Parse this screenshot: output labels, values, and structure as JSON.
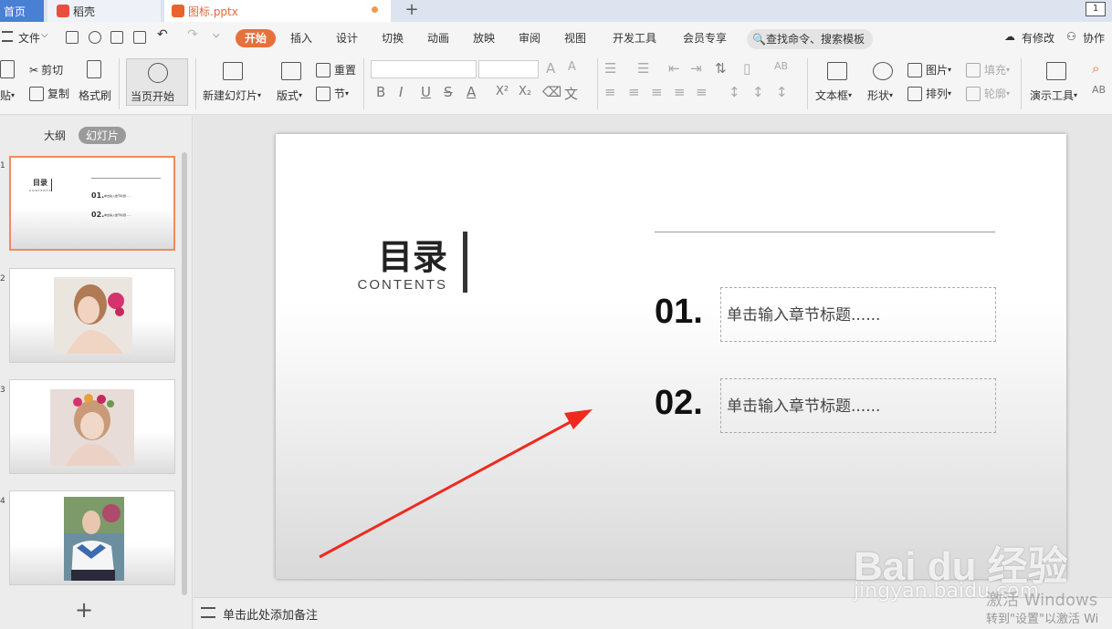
{
  "tabs": {
    "home": "首页",
    "docer": "稻壳",
    "file": "图标.pptx",
    "new_tab": "+",
    "window_badge": "1"
  },
  "menu": {
    "file": "文件",
    "items": [
      "开始",
      "插入",
      "设计",
      "切换",
      "动画",
      "放映",
      "审阅",
      "视图",
      "开发工具",
      "会员专享"
    ],
    "search_placeholder": "查找命令、搜索模板",
    "has_edit": "有修改",
    "collab": "协作"
  },
  "toolbar": {
    "paste": "贴",
    "cut": "剪切",
    "copy": "复制",
    "format_painter": "格式刷",
    "play_from_current": "当页开始",
    "new_slide": "新建幻灯片",
    "layout": "版式",
    "reset": "重置",
    "section": "节",
    "text_box": "文本框",
    "shape": "形状",
    "picture": "图片",
    "arrange": "排列",
    "fill": "填充",
    "outline": "轮廓",
    "presentation_tools": "演示工具",
    "fmt_glyphs": [
      "B",
      "I",
      "U",
      "S",
      "A",
      "X²",
      "X₂"
    ]
  },
  "left_pane": {
    "outline": "大纲",
    "slides": "幻灯片",
    "thumb1": {
      "title": "目录",
      "sub": "CONTENTS",
      "item1": "01.",
      "item2": "02.",
      "ph1": "单击输入章节标题......",
      "ph2": "单击输入章节标题......"
    },
    "slide_numbers": [
      "1",
      "2",
      "3",
      "4"
    ],
    "add": "+"
  },
  "slide": {
    "title": "目录",
    "subtitle": "CONTENTS",
    "items": [
      {
        "num": "01.",
        "placeholder": "单击输入章节标题......"
      },
      {
        "num": "02.",
        "placeholder": "单击输入章节标题......"
      }
    ]
  },
  "notes": {
    "placeholder": "单击此处添加备注"
  },
  "watermark": {
    "brand": "Bai du 经验",
    "url": "jingyan.baidu.com",
    "activate_1": "激活 Windows",
    "activate_2": "转到\"设置\"以激活 Wi"
  },
  "colors": {
    "accent": "#e8703a",
    "tab_blue": "#4a7fd6",
    "arrow_red": "#ee2a1f"
  }
}
